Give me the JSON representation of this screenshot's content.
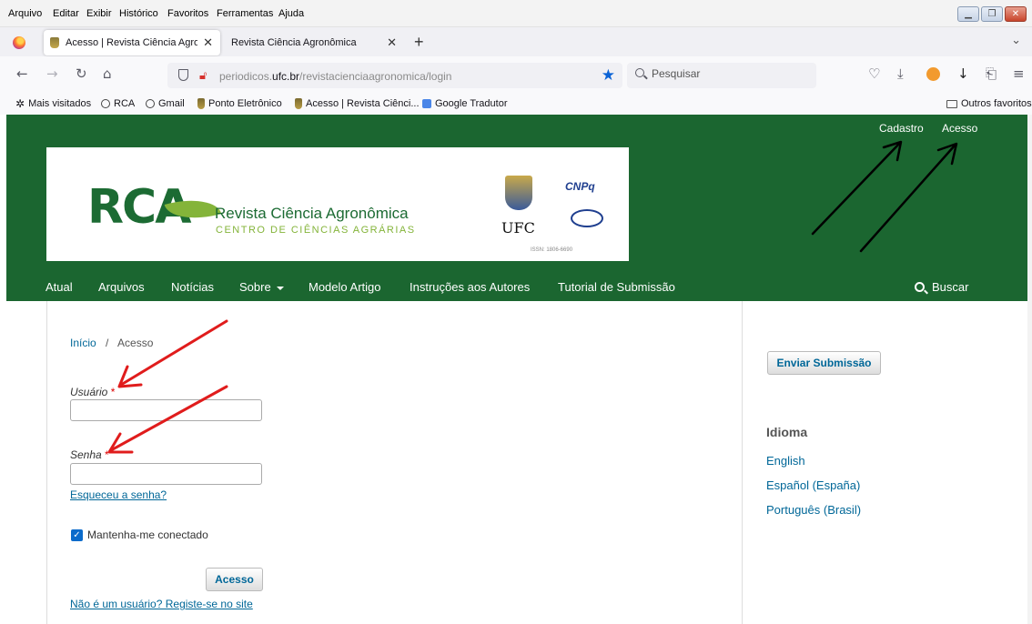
{
  "menubar": {
    "items": [
      "Arquivo",
      "Editar",
      "Exibir",
      "Histórico",
      "Favoritos",
      "Ferramentas",
      "Ajuda"
    ]
  },
  "tabs": [
    {
      "title": "Acesso | Revista Ciência Agronômica",
      "close": "✕"
    },
    {
      "title": "Revista Ciência Agronômica",
      "close": "✕"
    }
  ],
  "navbar": {
    "url_prefix": "periodicos.",
    "url_domain": "ufc.br",
    "url_path": "/revistacienciaagronomica/login",
    "search_placeholder": "Pesquisar"
  },
  "bookmarks": {
    "items": [
      "Mais visitados",
      "RCA",
      "Gmail",
      "Ponto Eletrônico",
      "Acesso | Revista Ciênci...",
      "Google Tradutor"
    ],
    "other": "Outros favoritos"
  },
  "header": {
    "user_links": [
      "Cadastro",
      "Acesso"
    ],
    "logo": {
      "acronym": "RCA",
      "title": "Revista Ciência Agronômica",
      "subtitle": "CENTRO DE CIÊNCIAS AGRÁRIAS",
      "ufc": "UFC",
      "cnpq": "CNPq",
      "issn": "ISSN: 1806-6690"
    },
    "nav": [
      "Atual",
      "Arquivos",
      "Notícias",
      "Sobre",
      "Modelo Artigo",
      "Instruções aos Autores",
      "Tutorial de Submissão"
    ],
    "search_label": "Buscar"
  },
  "breadcrumb": {
    "home": "Início",
    "separator": "/",
    "current": "Acesso"
  },
  "form": {
    "username_label": "Usuário",
    "password_label": "Senha",
    "required_mark": "*",
    "forgot_link": "Esqueceu a senha?",
    "remember_label": "Mantenha-me conectado",
    "remember_checked": true,
    "submit_label": "Acesso",
    "register_link": "Não é um usuário? Registe-se no site"
  },
  "sidebar": {
    "submit_button": "Enviar Submissão",
    "language_heading": "Idioma",
    "languages": [
      "English",
      "Español (España)",
      "Português (Brasil)"
    ]
  },
  "colors": {
    "header_green": "#1b6630",
    "link_blue": "#006798",
    "annotation_red": "#e01c1c",
    "annotation_black": "#000000"
  }
}
